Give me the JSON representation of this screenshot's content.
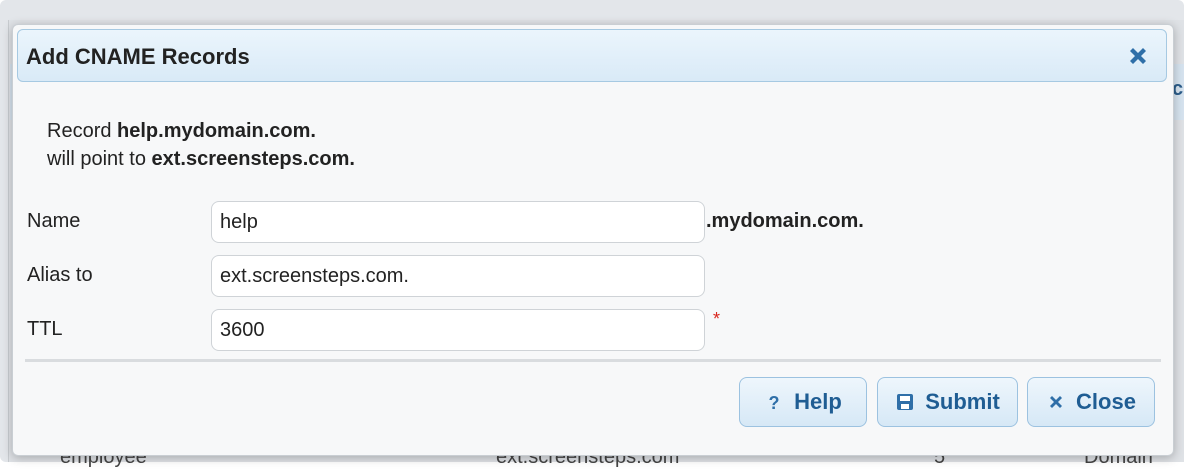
{
  "background": {
    "header_partial_letter": "c",
    "row_partial": [
      "employee",
      "ext.screensteps.com",
      "5",
      "Domain"
    ]
  },
  "dialog": {
    "title": "Add CNAME Records",
    "info": {
      "line1_prefix": "Record ",
      "record_name": "help.mydomain.com.",
      "line2_prefix": "will point to ",
      "alias_target": "ext.screensteps.com."
    },
    "form": {
      "name_label": "Name",
      "name_value": "help",
      "name_suffix": ".mydomain.com.",
      "alias_label": "Alias to",
      "alias_value": "ext.screensteps.com.",
      "ttl_label": "TTL",
      "ttl_value": "3600",
      "required_marker": "*"
    },
    "buttons": {
      "help": "Help",
      "submit": "Submit",
      "close": "Close"
    }
  },
  "colors": {
    "accent": "#1f5d93",
    "required": "#d9251d",
    "titlebar_border": "#a6c9e2"
  },
  "icons": [
    "close-icon",
    "help-icon",
    "save-icon"
  ]
}
